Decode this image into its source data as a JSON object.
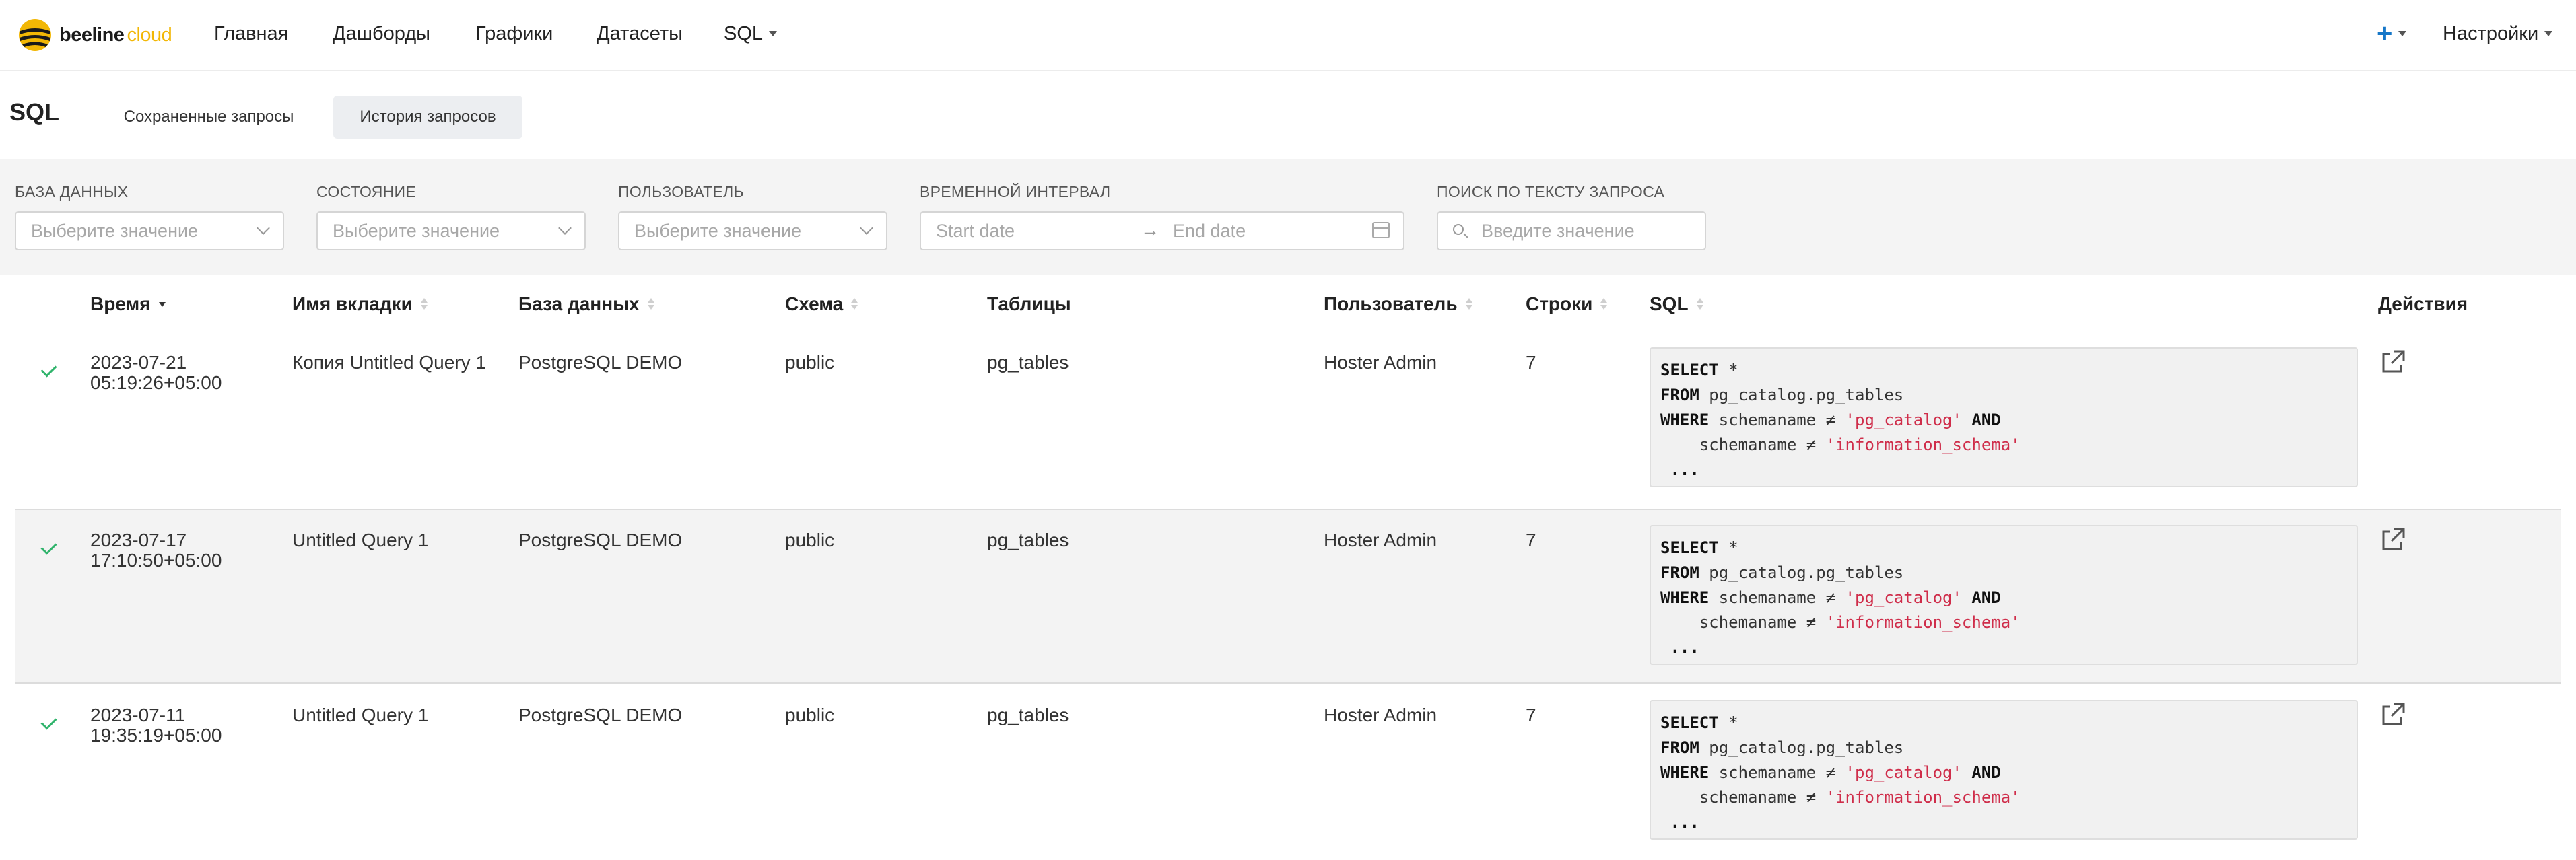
{
  "brand": {
    "name_part1": "beeline",
    "name_part2": "cloud"
  },
  "nav": {
    "items": [
      {
        "label": "Главная"
      },
      {
        "label": "Дашборды"
      },
      {
        "label": "Графики"
      },
      {
        "label": "Датасеты"
      },
      {
        "label": "SQL",
        "has_dropdown": true
      }
    ],
    "add_icon": "+",
    "settings_label": "Настройки"
  },
  "page": {
    "title": "SQL",
    "tabs": [
      {
        "label": "Сохраненные запросы",
        "active": false
      },
      {
        "label": "История запросов",
        "active": true
      }
    ]
  },
  "filters": {
    "database": {
      "label": "БАЗА ДАННЫХ",
      "placeholder": "Выберите значение"
    },
    "state": {
      "label": "СОСТОЯНИЕ",
      "placeholder": "Выберите значение"
    },
    "user": {
      "label": "ПОЛЬЗОВАТЕЛЬ",
      "placeholder": "Выберите значение"
    },
    "interval": {
      "label": "ВРЕМЕННОЙ ИНТЕРВАЛ",
      "start_placeholder": "Start date",
      "end_placeholder": "End date"
    },
    "search": {
      "label": "ПОИСК ПО ТЕКСТУ ЗАПРОСА",
      "placeholder": "Введите значение"
    }
  },
  "table": {
    "columns": {
      "time": "Время",
      "tab_name": "Имя вкладки",
      "database": "База данных",
      "schema": "Схема",
      "tables": "Таблицы",
      "user": "Пользователь",
      "rows": "Строки",
      "sql": "SQL",
      "actions": "Действия"
    },
    "rows": [
      {
        "status": "success",
        "time_date": "2023-07-21",
        "time_clock": "05:19:26+05:00",
        "tab_name": "Копия Untitled Query 1",
        "database": "PostgreSQL DEMO",
        "schema": "public",
        "tables": "pg_tables",
        "user": "Hoster Admin",
        "rows": "7"
      },
      {
        "status": "success",
        "time_date": "2023-07-17",
        "time_clock": "17:10:50+05:00",
        "tab_name": "Untitled Query 1",
        "database": "PostgreSQL DEMO",
        "schema": "public",
        "tables": "pg_tables",
        "user": "Hoster Admin",
        "rows": "7"
      },
      {
        "status": "success",
        "time_date": "2023-07-11",
        "time_clock": "19:35:19+05:00",
        "tab_name": "Untitled Query 1",
        "database": "PostgreSQL DEMO",
        "schema": "public",
        "tables": "pg_tables",
        "user": "Hoster Admin",
        "rows": "7"
      }
    ],
    "sql_preview": {
      "l1_kw": "SELECT",
      "l1_rest": " *",
      "l2_kw": "FROM",
      "l2_rest": " pg_catalog.pg_tables",
      "l3_kw": "WHERE",
      "l3_mid": " schemaname ≠ ",
      "l3_str": "'pg_catalog'",
      "l3_and": " AND",
      "l4_mid": "    schemaname ≠ ",
      "l4_str": "'information_schema'",
      "l5": " ..."
    }
  },
  "colors": {
    "accent": "#f2b705",
    "success": "#2fb36b",
    "string": "#cf2d4a",
    "link": "#1677c8"
  }
}
